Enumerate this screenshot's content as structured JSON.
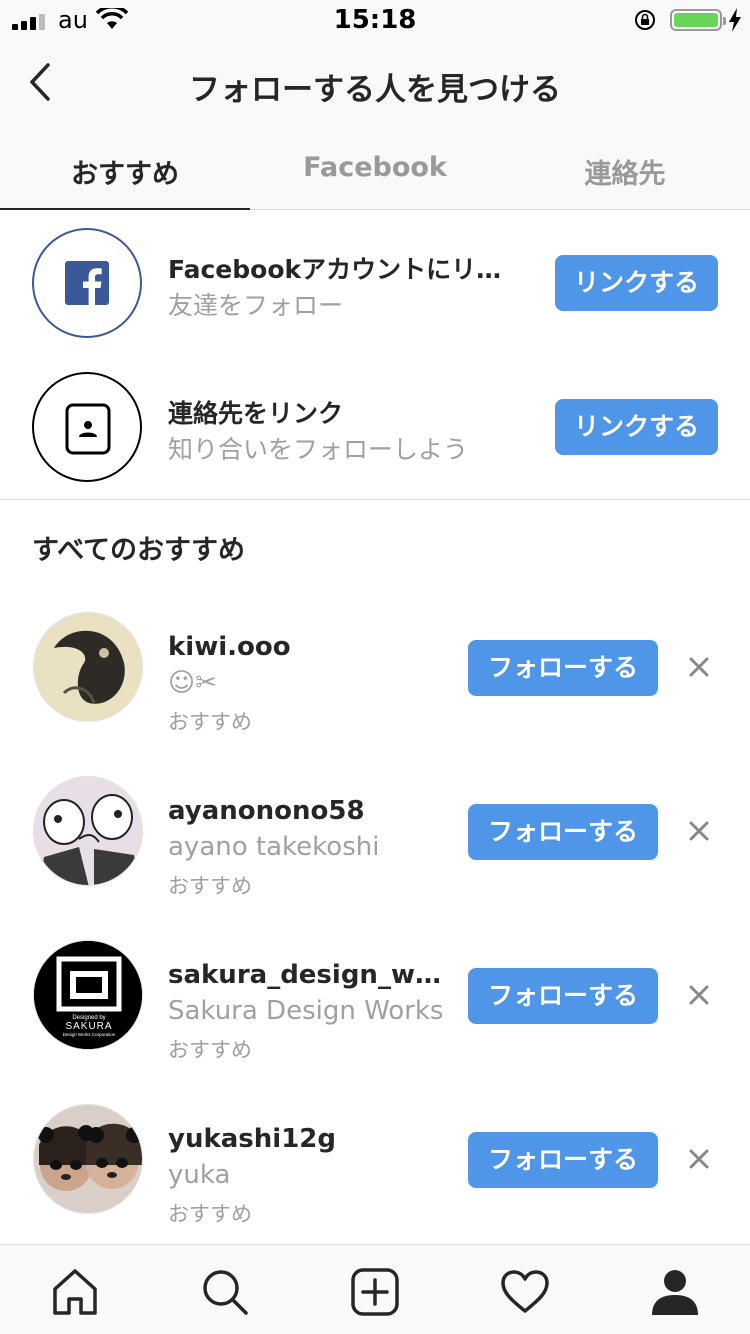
{
  "status_bar": {
    "carrier": "au",
    "time": "15:18",
    "battery_level": 1.0
  },
  "header": {
    "title": "フォローする人を見つける"
  },
  "tabs": [
    {
      "label": "おすすめ",
      "active": true
    },
    {
      "label": "Facebook",
      "active": false
    },
    {
      "label": "連絡先",
      "active": false
    }
  ],
  "link_rows": [
    {
      "title": "Facebookアカウントにリンク",
      "subtitle": "友達をフォロー",
      "button": "リンクする",
      "icon": "facebook-icon"
    },
    {
      "title": "連絡先をリンク",
      "subtitle": "知り合いをフォローしよう",
      "button": "リンクする",
      "icon": "contact-card-icon"
    }
  ],
  "section_title": "すべてのおすすめ",
  "suggestions": [
    {
      "username": "kiwi.ooo",
      "fullname": "☺✂",
      "reason": "おすすめ",
      "button": "フォローする"
    },
    {
      "username": "ayanonono58",
      "fullname": "ayano takekoshi",
      "reason": "おすすめ",
      "button": "フォローする"
    },
    {
      "username": "sakura_design_works",
      "fullname": "Sakura Design Works",
      "reason": "おすすめ",
      "button": "フォローする"
    },
    {
      "username": "yukashi12g",
      "fullname": "yuka",
      "reason": "おすすめ",
      "button": "フォローする"
    }
  ],
  "avatar_logo_text": {
    "line1": "Designed by",
    "line2": "SAKURA",
    "line3": "Design Works Corporation"
  },
  "tab_bar": [
    "home-icon",
    "search-icon",
    "add-post-icon",
    "activity-heart-icon",
    "profile-icon"
  ],
  "colors": {
    "accent": "#4f96e8",
    "facebook": "#3b5998"
  }
}
